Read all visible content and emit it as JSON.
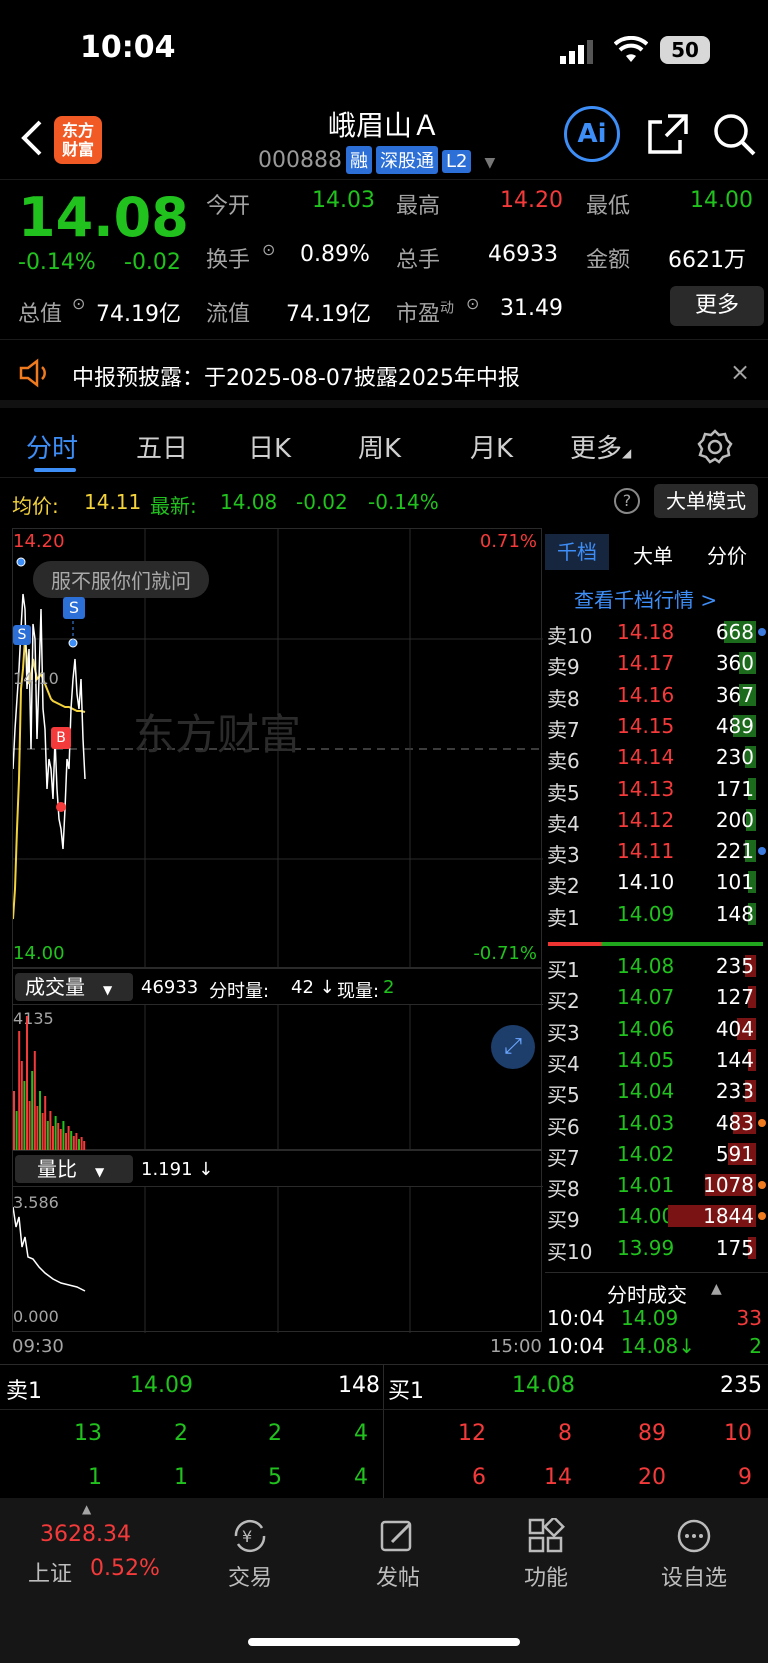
{
  "status_bar": {
    "time": "10:04",
    "battery": "50"
  },
  "header": {
    "title": "峨眉山Ａ",
    "code": "000888",
    "tags": [
      "融",
      "深股通",
      "L2"
    ],
    "logo_line1": "东方",
    "logo_line2": "财富",
    "ai_label": "Ai"
  },
  "quote": {
    "price": "14.08",
    "change_pct": "-0.14%",
    "change": "-0.02",
    "open_label": "今开",
    "open": "14.03",
    "high_label": "最高",
    "high": "14.20",
    "low_label": "最低",
    "low": "14.00",
    "turnover_label": "换手",
    "turnover": "0.89%",
    "volume_label": "总手",
    "volume": "46933",
    "amount_label": "金额",
    "amount": "6621万",
    "mktcap_label": "总值",
    "mktcap": "74.19亿",
    "float_label": "流值",
    "float": "74.19亿",
    "pe_label": "市盈",
    "pe_sup": "动",
    "pe": "31.49",
    "more_button": "更多"
  },
  "notice": {
    "text": "中报预披露：于2025-08-07披露2025年中报"
  },
  "tabs": [
    "分时",
    "五日",
    "日K",
    "周K",
    "月K",
    "更多"
  ],
  "chart_header": {
    "avg_label": "均价:",
    "avg": "14.11",
    "latest_label": "最新:",
    "latest": "14.08",
    "latest_chg": "-0.02",
    "latest_pct": "-0.14%",
    "mode_button": "大单模式"
  },
  "price_chart": {
    "ymax": "14.20",
    "ymid": "14.10",
    "ymin": "14.00",
    "pct_max": "0.71%",
    "pct_min": "-0.71%",
    "watermark": "东方财富",
    "bubble": "服不服你们就问",
    "time_start": "09:30",
    "time_end": "15:00"
  },
  "volume_panel": {
    "label": "成交量",
    "total": "46933",
    "min_label": "分时量:",
    "min_vol": "42 ↓",
    "now_label": "现量:",
    "now_vol": "2",
    "ymax": "4135"
  },
  "ratio_panel": {
    "label": "量比",
    "value": "1.191 ↓",
    "ymax": "3.586",
    "ymin": "0.000"
  },
  "orderbook": {
    "tabs": [
      "千档",
      "大单",
      "分价"
    ],
    "view_link": "查看千档行情 >",
    "asks": [
      {
        "label": "卖10",
        "price": "14.18",
        "vol": "668",
        "dot": "#3b7be0"
      },
      {
        "label": "卖9",
        "price": "14.17",
        "vol": "360",
        "dot": ""
      },
      {
        "label": "卖8",
        "price": "14.16",
        "vol": "367",
        "dot": ""
      },
      {
        "label": "卖7",
        "price": "14.15",
        "vol": "489",
        "dot": ""
      },
      {
        "label": "卖6",
        "price": "14.14",
        "vol": "230",
        "dot": ""
      },
      {
        "label": "卖5",
        "price": "14.13",
        "vol": "171",
        "dot": ""
      },
      {
        "label": "卖4",
        "price": "14.12",
        "vol": "200",
        "dot": ""
      },
      {
        "label": "卖3",
        "price": "14.11",
        "vol": "221",
        "dot": "#3b7be0"
      },
      {
        "label": "卖2",
        "price": "14.10",
        "vol": "101",
        "dot": ""
      },
      {
        "label": "卖1",
        "price": "14.09",
        "vol": "148",
        "dot": ""
      }
    ],
    "bids": [
      {
        "label": "买1",
        "price": "14.08",
        "vol": "235",
        "dot": ""
      },
      {
        "label": "买2",
        "price": "14.07",
        "vol": "127",
        "dot": ""
      },
      {
        "label": "买3",
        "price": "14.06",
        "vol": "404",
        "dot": ""
      },
      {
        "label": "买4",
        "price": "14.05",
        "vol": "144",
        "dot": ""
      },
      {
        "label": "买5",
        "price": "14.04",
        "vol": "233",
        "dot": ""
      },
      {
        "label": "买6",
        "price": "14.03",
        "vol": "483",
        "dot": "#f07a1e"
      },
      {
        "label": "买7",
        "price": "14.02",
        "vol": "591",
        "dot": ""
      },
      {
        "label": "买8",
        "price": "14.01",
        "vol": "1078",
        "dot": "#f07a1e"
      },
      {
        "label": "买9",
        "price": "14.00",
        "vol": "1844",
        "dot": "#f07a1e"
      },
      {
        "label": "买10",
        "price": "13.99",
        "vol": "175",
        "dot": ""
      }
    ],
    "trades_title": "分时成交",
    "trades": [
      {
        "time": "10:04",
        "price": "14.09",
        "vol": "33"
      },
      {
        "time": "10:04",
        "price": "14.08↓",
        "vol": "2"
      }
    ]
  },
  "level_panel": {
    "sell_label": "卖1",
    "sell_price": "14.09",
    "sell_vol": "148",
    "buy_label": "买1",
    "buy_price": "14.08",
    "buy_vol": "235",
    "sell_rows": [
      [
        "13",
        "2",
        "2",
        "4"
      ],
      [
        "1",
        "1",
        "5",
        "4"
      ]
    ],
    "buy_rows": [
      [
        "12",
        "8",
        "89",
        "10"
      ],
      [
        "6",
        "14",
        "20",
        "9"
      ]
    ]
  },
  "bottom_nav": {
    "index_value": "3628.34",
    "index_name": "上证",
    "index_pct": "0.52%",
    "items": [
      "交易",
      "发帖",
      "功能",
      "设自选"
    ]
  }
}
